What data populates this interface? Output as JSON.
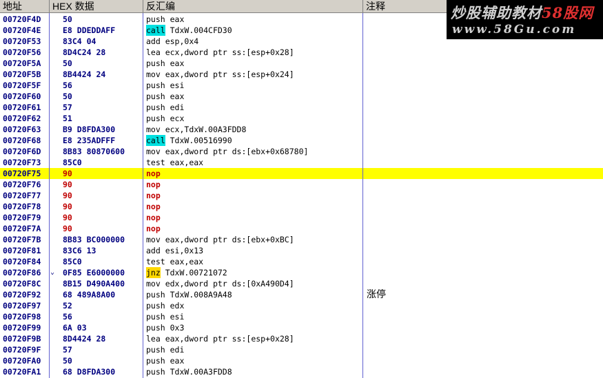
{
  "headers": {
    "address": "地址",
    "hex": "HEX 数据",
    "disasm": "反汇编",
    "comment": "注释"
  },
  "watermark": {
    "line1_prefix": "炒股辅助教材",
    "line1_brand": "58股网",
    "line2": "www.58Gu.com"
  },
  "colors": {
    "highlight_row": "#ffff00",
    "call_highlight": "#00e0e0",
    "jump_highlight": "#ffd800",
    "nop_text": "#c00000",
    "address_text": "#000080"
  },
  "rows": [
    {
      "addr": "00720F4D",
      "hex": "50",
      "mn": "push",
      "ops": " eax",
      "comment": ""
    },
    {
      "addr": "00720F4E",
      "hex": "E8 DDEDDAFF",
      "mn": "call",
      "ops": " TdxW.004CFD30",
      "comment": ""
    },
    {
      "addr": "00720F53",
      "hex": "83C4 04",
      "mn": "add",
      "ops": " esp,0x4",
      "comment": ""
    },
    {
      "addr": "00720F56",
      "hex": "8D4C24 28",
      "mn": "lea",
      "ops": " ecx,dword ptr ss:[esp+0x28]",
      "comment": ""
    },
    {
      "addr": "00720F5A",
      "hex": "50",
      "mn": "push",
      "ops": " eax",
      "comment": ""
    },
    {
      "addr": "00720F5B",
      "hex": "8B4424 24",
      "mn": "mov",
      "ops": " eax,dword ptr ss:[esp+0x24]",
      "comment": ""
    },
    {
      "addr": "00720F5F",
      "hex": "56",
      "mn": "push",
      "ops": " esi",
      "comment": ""
    },
    {
      "addr": "00720F60",
      "hex": "50",
      "mn": "push",
      "ops": " eax",
      "comment": ""
    },
    {
      "addr": "00720F61",
      "hex": "57",
      "mn": "push",
      "ops": " edi",
      "comment": ""
    },
    {
      "addr": "00720F62",
      "hex": "51",
      "mn": "push",
      "ops": " ecx",
      "comment": ""
    },
    {
      "addr": "00720F63",
      "hex": "B9 D8FDA300",
      "mn": "mov",
      "ops": " ecx,TdxW.00A3FDD8",
      "comment": ""
    },
    {
      "addr": "00720F68",
      "hex": "E8 235ADFFF",
      "mn": "call",
      "ops": " TdxW.00516990",
      "comment": ""
    },
    {
      "addr": "00720F6D",
      "hex": "8B83 80870600",
      "mn": "mov",
      "ops": " eax,dword ptr ds:[ebx+0x68780]",
      "comment": ""
    },
    {
      "addr": "00720F73",
      "hex": "85C0",
      "mn": "test",
      "ops": " eax,eax",
      "comment": ""
    },
    {
      "addr": "00720F75",
      "hex": "90",
      "mn": "nop",
      "ops": "",
      "comment": ""
    },
    {
      "addr": "00720F76",
      "hex": "90",
      "mn": "nop",
      "ops": "",
      "comment": ""
    },
    {
      "addr": "00720F77",
      "hex": "90",
      "mn": "nop",
      "ops": "",
      "comment": ""
    },
    {
      "addr": "00720F78",
      "hex": "90",
      "mn": "nop",
      "ops": "",
      "comment": ""
    },
    {
      "addr": "00720F79",
      "hex": "90",
      "mn": "nop",
      "ops": "",
      "comment": ""
    },
    {
      "addr": "00720F7A",
      "hex": "90",
      "mn": "nop",
      "ops": "",
      "comment": ""
    },
    {
      "addr": "00720F7B",
      "hex": "8B83 BC000000",
      "mn": "mov",
      "ops": " eax,dword ptr ds:[ebx+0xBC]",
      "comment": ""
    },
    {
      "addr": "00720F81",
      "hex": "83C6 13",
      "mn": "add",
      "ops": " esi,0x13",
      "comment": ""
    },
    {
      "addr": "00720F84",
      "hex": "85C0",
      "mn": "test",
      "ops": " eax,eax",
      "comment": ""
    },
    {
      "addr": "00720F86",
      "hex": "0F85 E6000000",
      "mn": "jnz",
      "ops": " TdxW.00721072",
      "comment": ""
    },
    {
      "addr": "00720F8C",
      "hex": "8B15 D490A400",
      "mn": "mov",
      "ops": " edx,dword ptr ds:[0xA490D4]",
      "comment": ""
    },
    {
      "addr": "00720F92",
      "hex": "68 489A8A00",
      "mn": "push",
      "ops": " TdxW.008A9A48",
      "comment": "涨停"
    },
    {
      "addr": "00720F97",
      "hex": "52",
      "mn": "push",
      "ops": " edx",
      "comment": ""
    },
    {
      "addr": "00720F98",
      "hex": "56",
      "mn": "push",
      "ops": " esi",
      "comment": ""
    },
    {
      "addr": "00720F99",
      "hex": "6A 03",
      "mn": "push",
      "ops": " 0x3",
      "comment": ""
    },
    {
      "addr": "00720F9B",
      "hex": "8D4424 28",
      "mn": "lea",
      "ops": " eax,dword ptr ss:[esp+0x28]",
      "comment": ""
    },
    {
      "addr": "00720F9F",
      "hex": "57",
      "mn": "push",
      "ops": " edi",
      "comment": ""
    },
    {
      "addr": "00720FA0",
      "hex": "50",
      "mn": "push",
      "ops": " eax",
      "comment": ""
    },
    {
      "addr": "00720FA1",
      "hex": "68 D8FDA300",
      "mn": "push",
      "ops": " TdxW.00A3FDD8",
      "comment": ""
    }
  ],
  "selected_address": "00720F75",
  "jump_arrow_address": "00720F86",
  "jump_arrow_glyph": "⌄"
}
